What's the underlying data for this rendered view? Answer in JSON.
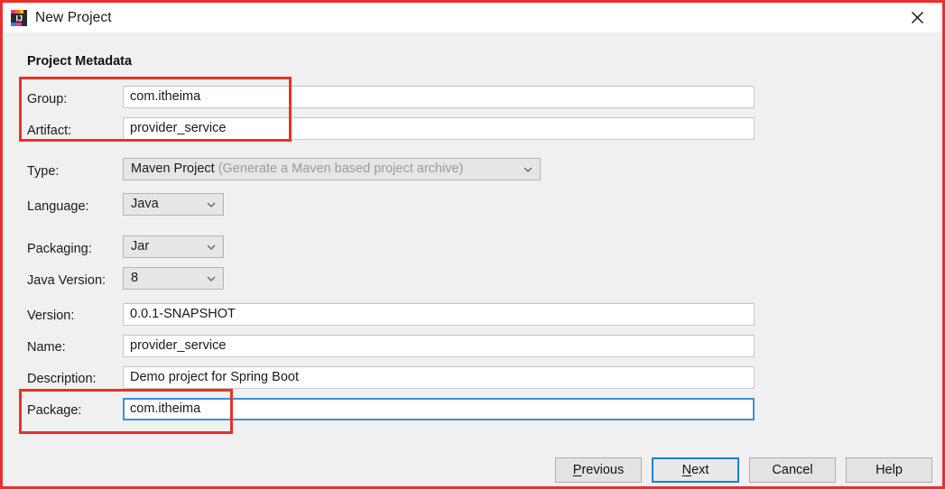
{
  "window": {
    "title": "New Project",
    "icon": "intellij-idea-icon",
    "close_icon": "close-icon",
    "accent_red": "#e8312a",
    "focus_blue": "#3a91d8",
    "body_bg": "#f0f0f0"
  },
  "section": {
    "heading": "Project Metadata"
  },
  "fields": [
    {
      "id": "group",
      "label": "Group:",
      "value": "com.itheima",
      "kind": "text"
    },
    {
      "id": "artifact",
      "label": "Artifact:",
      "value": "provider_service",
      "kind": "text"
    },
    {
      "id": "type",
      "label": "Type:",
      "value": "Maven Project",
      "hint": "(Generate a Maven based project archive)",
      "kind": "combo"
    },
    {
      "id": "language",
      "label": "Language:",
      "value": "Java",
      "kind": "combo"
    },
    {
      "id": "packaging",
      "label": "Packaging:",
      "value": "Jar",
      "kind": "combo"
    },
    {
      "id": "java_version",
      "label": "Java Version:",
      "value": "8",
      "kind": "combo"
    },
    {
      "id": "version",
      "label": "Version:",
      "value": "0.0.1-SNAPSHOT",
      "kind": "text"
    },
    {
      "id": "name",
      "label": "Name:",
      "value": "provider_service",
      "kind": "text"
    },
    {
      "id": "description",
      "label": "Description:",
      "value": "Demo project for Spring Boot",
      "kind": "text"
    },
    {
      "id": "package",
      "label": "Package:",
      "value": "com.itheima",
      "kind": "text",
      "focused": true
    }
  ],
  "buttons": {
    "previous": {
      "label_pre": "",
      "mnemonic": "P",
      "label_post": "revious"
    },
    "next": {
      "label_pre": "",
      "mnemonic": "N",
      "label_post": "ext"
    },
    "cancel": {
      "label": "Cancel"
    },
    "help": {
      "label": "Help"
    }
  },
  "annotations": [
    {
      "name": "group-artifact-highlight"
    },
    {
      "name": "package-highlight"
    }
  ]
}
